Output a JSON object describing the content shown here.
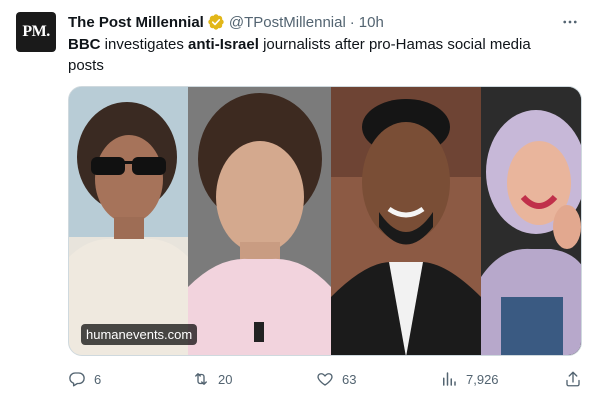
{
  "author": {
    "avatar_text": "PM.",
    "name": "The Post Millennial",
    "handle": "@TPostMillennial",
    "separator": "·",
    "time": "10h"
  },
  "tweet": {
    "parts": [
      {
        "text": "BBC",
        "bold": true
      },
      {
        "text": " investigates ",
        "bold": false
      },
      {
        "text": "anti-Israel",
        "bold": true
      },
      {
        "text": " journalists after pro-Hamas social media posts",
        "bold": false
      }
    ]
  },
  "media": {
    "watermark": "humanevents.com",
    "photo_count": 4
  },
  "actions": {
    "replies": "6",
    "retweets": "20",
    "likes": "63",
    "views": "7,926"
  },
  "icons": {
    "verified": "verified-badge-icon",
    "more": "more-icon",
    "reply": "reply-icon",
    "retweet": "retweet-icon",
    "like": "heart-icon",
    "views": "views-icon",
    "share": "share-icon"
  },
  "colors": {
    "text": "#0f1419",
    "secondary": "#536471",
    "verified_gold": "#e2b719",
    "border": "#cfd9de"
  }
}
